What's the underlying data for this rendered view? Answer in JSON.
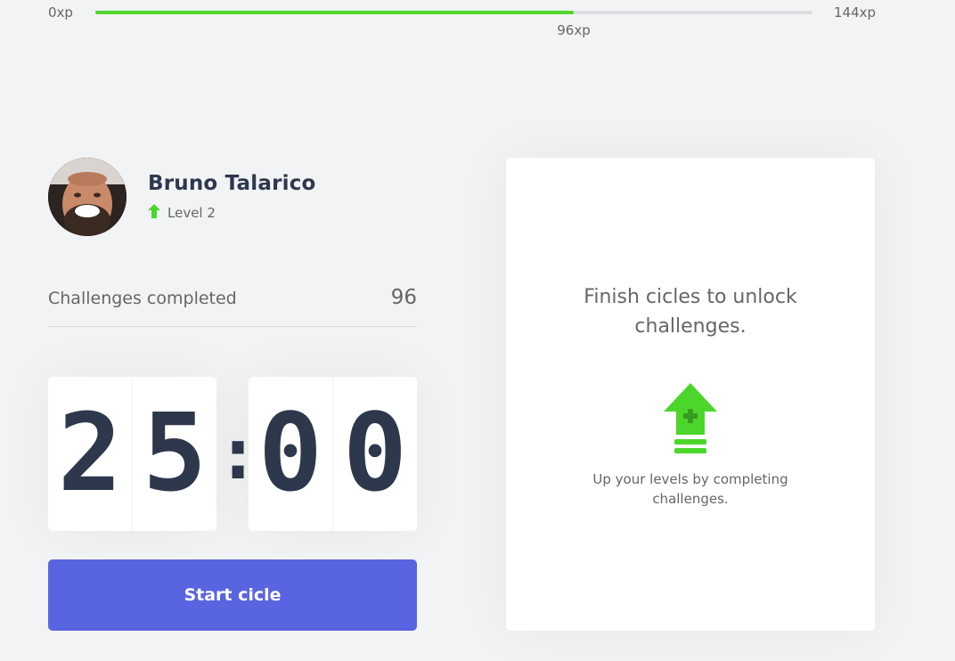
{
  "experience": {
    "min_label": "0xp",
    "max_label": "144xp",
    "current_label": "96xp",
    "current_xp": 96,
    "max_xp": 144
  },
  "profile": {
    "name": "Bruno Talarico",
    "level_label": "Level 2",
    "level_icon": "level-up-arrow-icon"
  },
  "challenges": {
    "label": "Challenges completed",
    "count": "96"
  },
  "countdown": {
    "minute_left": "2",
    "minute_right": "5",
    "separator": ":",
    "second_left": "0",
    "second_right": "0"
  },
  "start_button": {
    "label": "Start cicle"
  },
  "challenge_box": {
    "title": "Finish cicles to unlock challenges.",
    "hint": "Up your levels by completing challenges.",
    "icon": "level-up-icon"
  },
  "colors": {
    "accent_green": "#4cd62b",
    "button_blue": "#5965e0",
    "title_dark": "#2e384d",
    "text_gray": "#666666",
    "background": "#f2f3f5"
  }
}
